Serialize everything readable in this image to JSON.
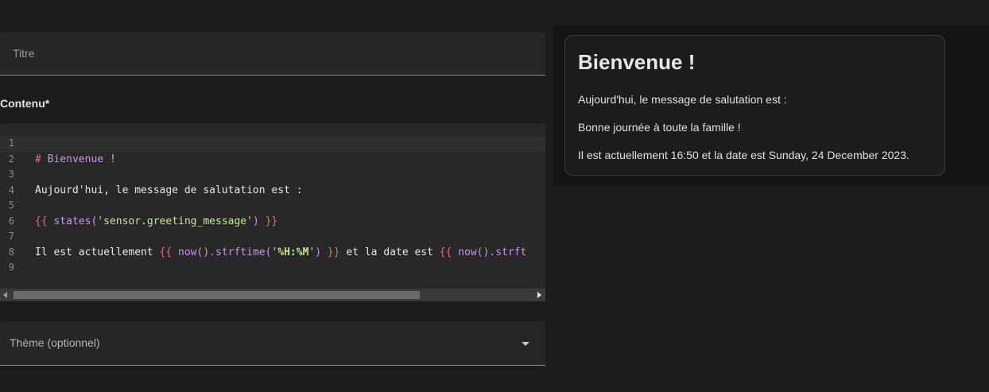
{
  "form": {
    "title_placeholder": "Titre",
    "content_label": "Contenu*",
    "theme_placeholder": "Thème (optionnel)"
  },
  "editor": {
    "line_numbers": [
      "1",
      "2",
      "3",
      "4",
      "5",
      "6",
      "7",
      "8",
      "9"
    ],
    "lines": {
      "l2": {
        "hash": "# ",
        "head": "Bienvenue ",
        "bang": "!"
      },
      "l4": {
        "text": "Aujourd'hui, le message de salutation est :"
      },
      "l6": {
        "open": "{{ ",
        "fn": "states(",
        "str": "'sensor.greeting_message'",
        "fnclose": ")",
        "close": " }}"
      },
      "l8": {
        "t1": "Il est actuellement ",
        "open1": "{{ ",
        "fn1": "now().strftime(",
        "q1": "'",
        "fmt1": "%H:%M",
        "q2": "'",
        "fnclose1": ")",
        "close1": " }}",
        "t2": " et la date est ",
        "open2": "{{ ",
        "fn2": "now().strft"
      }
    }
  },
  "preview": {
    "heading": "Bienvenue !",
    "p1": "Aujourd'hui, le message de salutation est :",
    "p2": "Bonne journée à toute la famille !",
    "p3": "Il est actuellement 16:50 et la date est Sunday, 24 December 2023."
  }
}
